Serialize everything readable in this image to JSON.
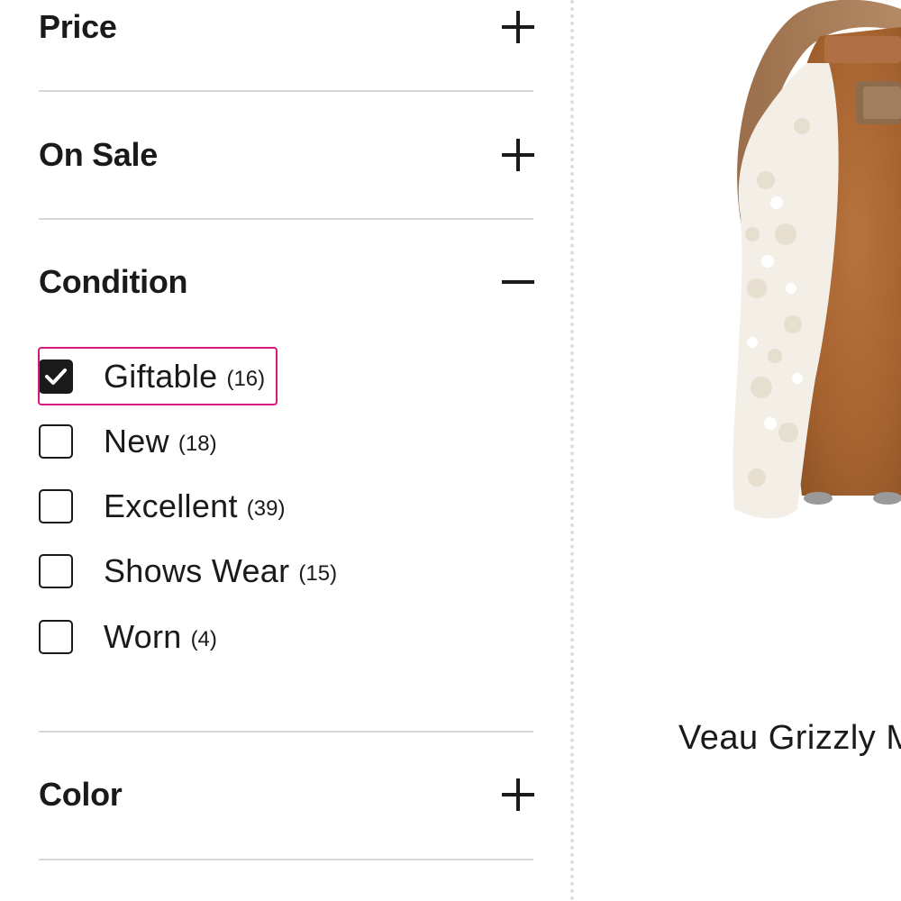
{
  "filters": {
    "sections": [
      {
        "title": "Price",
        "expanded": false,
        "toggle_icon": "plus-icon"
      },
      {
        "title": "On Sale",
        "expanded": false,
        "toggle_icon": "plus-icon"
      },
      {
        "title": "Condition",
        "expanded": true,
        "toggle_icon": "minus-icon"
      },
      {
        "title": "Color",
        "expanded": false,
        "toggle_icon": "plus-icon"
      }
    ],
    "condition_options": [
      {
        "label": "Giftable",
        "count": "(16)",
        "checked": true
      },
      {
        "label": "New",
        "count": "(18)",
        "checked": false
      },
      {
        "label": "Excellent",
        "count": "(39)",
        "checked": false
      },
      {
        "label": "Shows Wear",
        "count": "(15)",
        "checked": false
      },
      {
        "label": "Worn",
        "count": "(4)",
        "checked": false
      }
    ],
    "highlight_color": "#d6177f"
  },
  "product": {
    "name": "Veau Grizzly M",
    "image": "brown-suede-shearling-handbag"
  }
}
